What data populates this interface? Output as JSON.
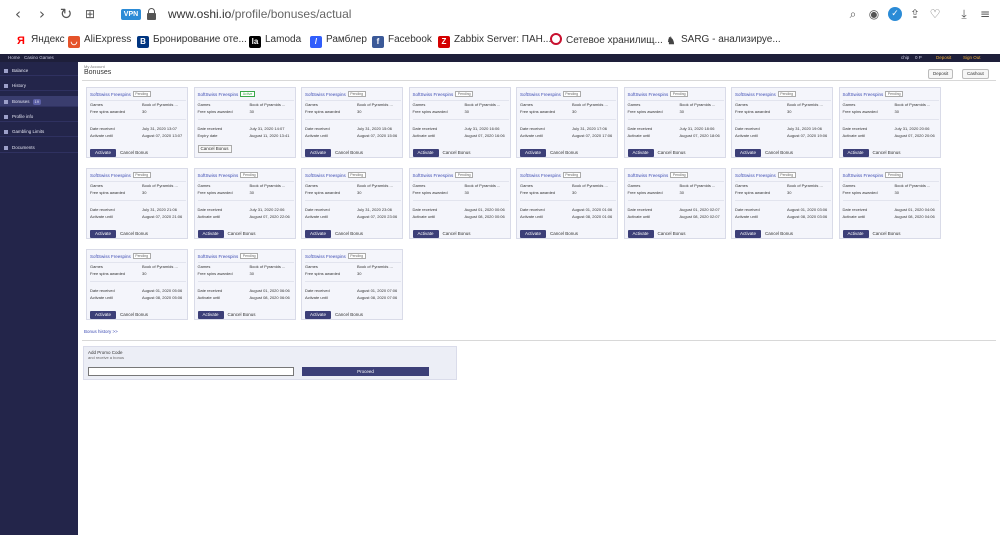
{
  "browser": {
    "vpn_label": "VPN",
    "url_host": "www.oshi.io",
    "url_path": "/profile/bonuses/actual",
    "bookmarks": [
      {
        "label": "Яндекс",
        "icon": "yandex-icon",
        "color": "#ff0000"
      },
      {
        "label": "AliExpress",
        "icon": "aliexpress-icon",
        "color": "#e5532a"
      },
      {
        "label": "Бронирование оте...",
        "icon": "booking-icon",
        "color": "#003580"
      },
      {
        "label": "Lamoda",
        "icon": "lamoda-icon",
        "color": "#000000"
      },
      {
        "label": "Рамблер",
        "icon": "rambler-icon",
        "color": "#315efb"
      },
      {
        "label": "Facebook",
        "icon": "facebook-icon",
        "color": "#3b5998"
      },
      {
        "label": "Zabbix Server: ПАН...",
        "icon": "zabbix-icon",
        "color": "#d40000"
      },
      {
        "label": "Сетевое хранилищ...",
        "icon": "storage-icon",
        "color": "#c8102e"
      },
      {
        "label": "SARG - анализируе...",
        "icon": "sarg-icon",
        "color": "#444444"
      }
    ]
  },
  "site_header": {
    "home": "Home",
    "casino": "Casino Games",
    "user": "chip",
    "points": "0 P",
    "deposit": "Deposit",
    "signout": "Sign Out"
  },
  "sidebar": {
    "items": [
      {
        "label": "Balance"
      },
      {
        "label": "History"
      },
      {
        "label": "Bonuses",
        "count": "19"
      },
      {
        "label": "Profile info"
      },
      {
        "label": "Gambling Limits"
      },
      {
        "label": "Documents"
      }
    ]
  },
  "main": {
    "breadcrumb": "My Account",
    "title": "Bonuses",
    "deposit_btn": "Deposit",
    "cashout_btn": "Cashout",
    "labels": {
      "games": "Games",
      "free_spins": "Free spins awarded",
      "date_received": "Date received",
      "activate_until": "Activate until",
      "expiry_date": "Expiry date",
      "activate_btn": "Activate",
      "cancel_bonus": "Cancel Bonus"
    },
    "cards": [
      {
        "title": "SoftSwiss Freespins",
        "badge": "Pending",
        "game": "Book of Pyramids ...",
        "spins": "30",
        "received": "July 31, 2020 13:07",
        "until": "August 07, 2020 13:07",
        "active": false
      },
      {
        "title": "SoftSwiss Freespins",
        "badge": "Active",
        "game": "Book of Pyramids ...",
        "spins": "30",
        "received": "July 31, 2020 14:07",
        "until": "August 11, 2020 13:41",
        "active": true
      },
      {
        "title": "SoftSwiss Freespins",
        "badge": "Pending",
        "game": "Book of Pyramids ...",
        "spins": "30",
        "received": "July 31, 2020 15:06",
        "until": "August 07, 2020 15:06",
        "active": false
      },
      {
        "title": "SoftSwiss Freespins",
        "badge": "Pending",
        "game": "Book of Pyramids ...",
        "spins": "30",
        "received": "July 31, 2020 16:06",
        "until": "August 07, 2020 16:06",
        "active": false
      },
      {
        "title": "SoftSwiss Freespins",
        "badge": "Pending",
        "game": "Book of Pyramids ...",
        "spins": "30",
        "received": "July 31, 2020 17:06",
        "until": "August 07, 2020 17:06",
        "active": false
      },
      {
        "title": "SoftSwiss Freespins",
        "badge": "Pending",
        "game": "Book of Pyramids ...",
        "spins": "30",
        "received": "July 31, 2020 18:06",
        "until": "August 07, 2020 18:06",
        "active": false
      },
      {
        "title": "SoftSwiss Freespins",
        "badge": "Pending",
        "game": "Book of Pyramids ...",
        "spins": "30",
        "received": "July 31, 2020 19:06",
        "until": "August 07, 2020 19:06",
        "active": false
      },
      {
        "title": "SoftSwiss Freespins",
        "badge": "Pending",
        "game": "Book of Pyramids ...",
        "spins": "30",
        "received": "July 31, 2020 20:06",
        "until": "August 07, 2020 20:06",
        "active": false
      },
      {
        "title": "SoftSwiss Freespins",
        "badge": "Pending",
        "game": "Book of Pyramids ...",
        "spins": "30",
        "received": "July 31, 2020 21:06",
        "until": "August 07, 2020 21:06",
        "active": false
      },
      {
        "title": "SoftSwiss Freespins",
        "badge": "Pending",
        "game": "Book of Pyramids ...",
        "spins": "30",
        "received": "July 31, 2020 22:06",
        "until": "August 07, 2020 22:06",
        "active": false
      },
      {
        "title": "SoftSwiss Freespins",
        "badge": "Pending",
        "game": "Book of Pyramids ...",
        "spins": "30",
        "received": "July 31, 2020 23:06",
        "until": "August 07, 2020 23:06",
        "active": false
      },
      {
        "title": "SoftSwiss Freespins",
        "badge": "Pending",
        "game": "Book of Pyramids ...",
        "spins": "30",
        "received": "August 01, 2020 00:06",
        "until": "August 08, 2020 00:06",
        "active": false
      },
      {
        "title": "SoftSwiss Freespins",
        "badge": "Pending",
        "game": "Book of Pyramids ...",
        "spins": "30",
        "received": "August 01, 2020 01:06",
        "until": "August 08, 2020 01:06",
        "active": false
      },
      {
        "title": "SoftSwiss Freespins",
        "badge": "Pending",
        "game": "Book of Pyramids ...",
        "spins": "30",
        "received": "August 01, 2020 02:07",
        "until": "August 08, 2020 02:07",
        "active": false
      },
      {
        "title": "SoftSwiss Freespins",
        "badge": "Pending",
        "game": "Book of Pyramids ...",
        "spins": "30",
        "received": "August 01, 2020 03:06",
        "until": "August 08, 2020 03:06",
        "active": false
      },
      {
        "title": "SoftSwiss Freespins",
        "badge": "Pending",
        "game": "Book of Pyramids ...",
        "spins": "30",
        "received": "August 01, 2020 04:06",
        "until": "August 08, 2020 04:06",
        "active": false
      },
      {
        "title": "SoftSwiss Freespins",
        "badge": "Pending",
        "game": "Book of Pyramids ...",
        "spins": "30",
        "received": "August 01, 2020 05:06",
        "until": "August 08, 2020 05:06",
        "active": false
      },
      {
        "title": "SoftSwiss Freespins",
        "badge": "Pending",
        "game": "Book of Pyramids ...",
        "spins": "30",
        "received": "August 01, 2020 06:06",
        "until": "August 08, 2020 06:06",
        "active": false
      },
      {
        "title": "SoftSwiss Freespins",
        "badge": "Pending",
        "game": "Book of Pyramids ...",
        "spins": "30",
        "received": "August 01, 2020 07:06",
        "until": "August 08, 2020 07:06",
        "active": false
      }
    ],
    "history_link": "Bonus history >>",
    "promo": {
      "title": "Add Promo Code",
      "subtitle": "and receive a bonus",
      "input_value": "",
      "proceed": "Proceed"
    }
  },
  "colors": {
    "sidebar": "#23254a",
    "accent": "#3c3f78",
    "link": "#3c4bb3"
  }
}
